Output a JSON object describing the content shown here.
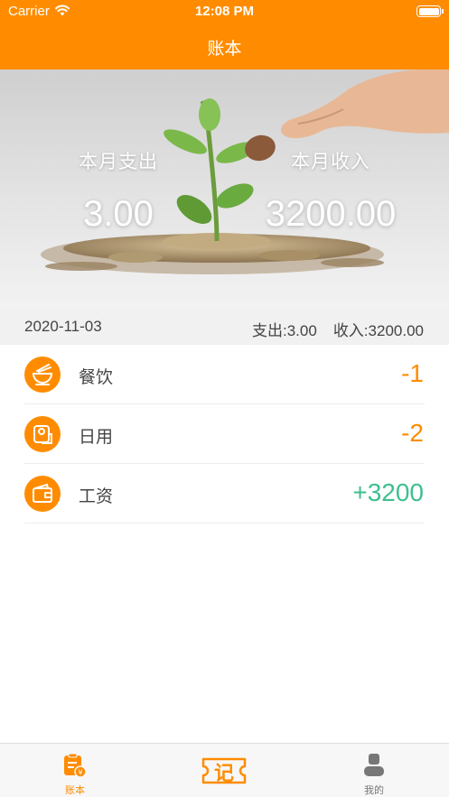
{
  "status_bar": {
    "carrier": "Carrier",
    "time": "12:08 PM"
  },
  "nav": {
    "title": "账本"
  },
  "banner": {
    "expense_label": "本月支出",
    "expense_value": "3.00",
    "income_label": "本月收入",
    "income_value": "3200.00"
  },
  "summary": {
    "date": "2020-11-03",
    "expense": "支出:3.00",
    "income": "收入:3200.00"
  },
  "records": [
    {
      "name": "餐饮",
      "amount": "-1",
      "icon": "bowl-icon",
      "type": "expense"
    },
    {
      "name": "日用",
      "amount": "-2",
      "icon": "tissue-roll-icon",
      "type": "expense"
    },
    {
      "name": "工资",
      "amount": "+3200",
      "icon": "wallet-icon",
      "type": "income"
    }
  ],
  "tab_bar": {
    "ledger_label": "账本",
    "record_label": "记",
    "mine_label": "我的"
  },
  "colors": {
    "accent": "#ff8c00",
    "income": "#3fbf8f",
    "expense": "#ff8c00"
  }
}
